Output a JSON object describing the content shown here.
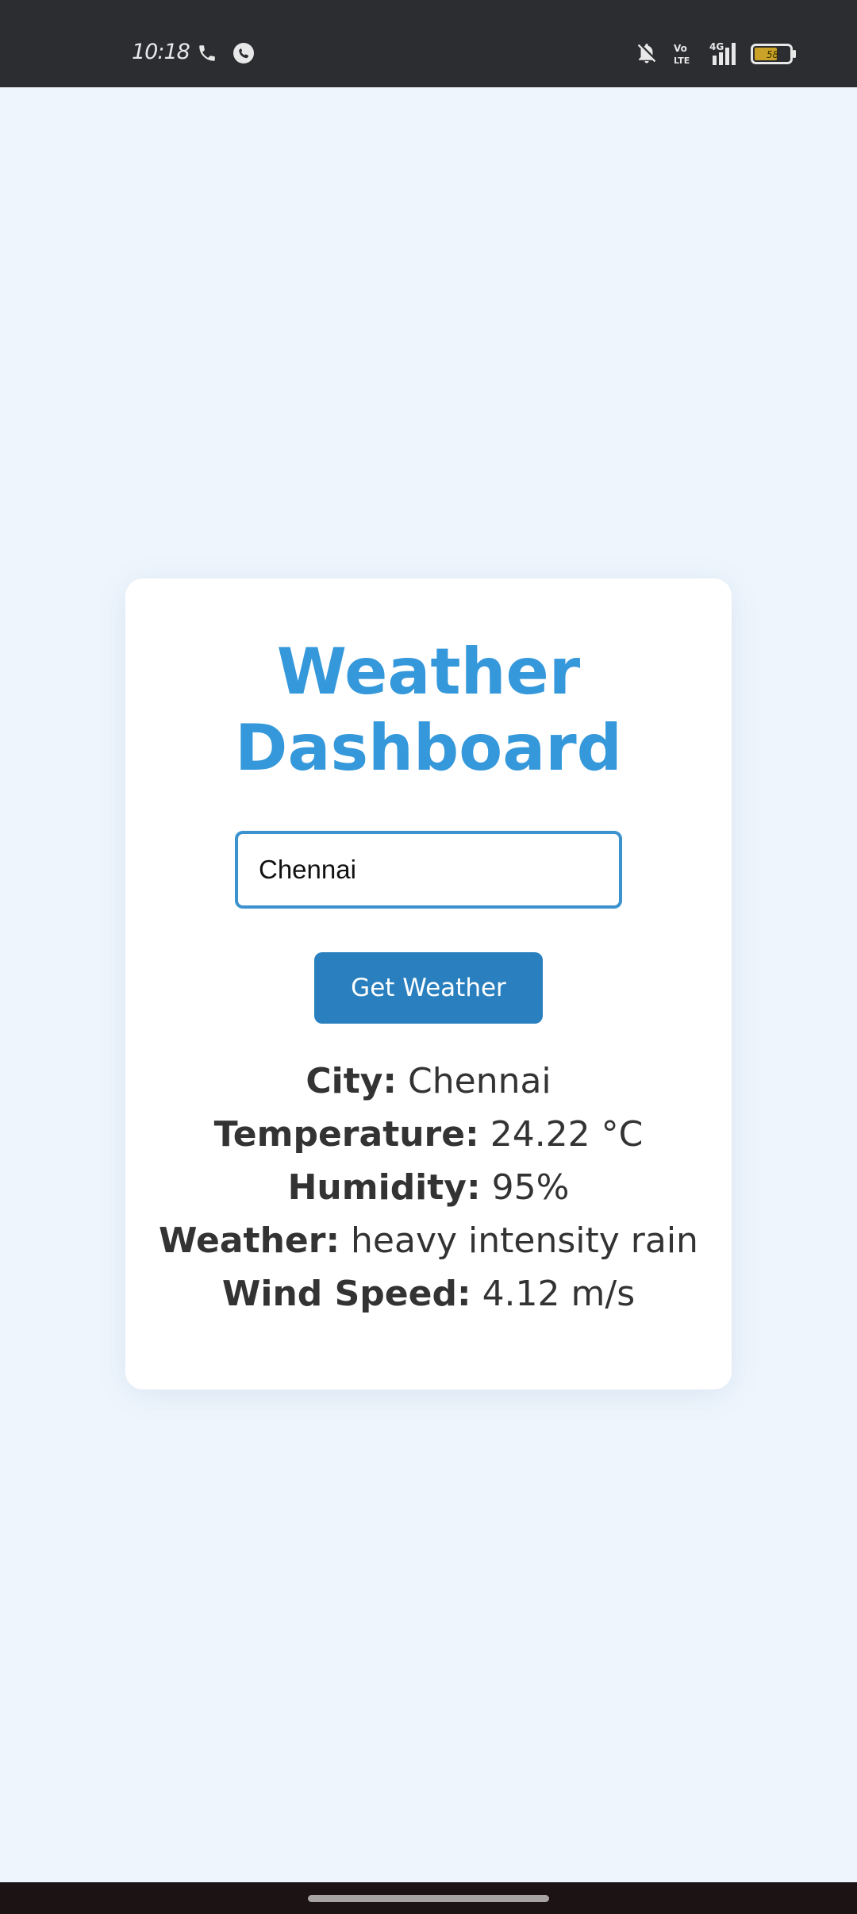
{
  "status_bar": {
    "time": "10:18",
    "left_icons": [
      "phone-icon",
      "whatsapp-icon"
    ],
    "right_icons": [
      "bell-off-icon",
      "volte-icon",
      "signal-4g-icon",
      "battery-icon"
    ],
    "network_label": "4G",
    "volte_label_top": "Vo",
    "volte_label_bottom": "LTE",
    "battery_level": "58",
    "battery_fill_color": "#c9a227"
  },
  "dashboard": {
    "title": "Weather Dashboard",
    "city_input": {
      "value": "Chennai",
      "placeholder": ""
    },
    "button_label": "Get Weather",
    "results": {
      "city_label": "City:",
      "city_value": "Chennai",
      "temperature_label": "Temperature:",
      "temperature_value": "24.22 °C",
      "humidity_label": "Humidity:",
      "humidity_value": "95%",
      "weather_label": "Weather:",
      "weather_value": "heavy intensity rain",
      "wind_label": "Wind Speed:",
      "wind_value": "4.12 m/s"
    }
  },
  "colors": {
    "accent": "#3498db",
    "button": "#2a80bf",
    "background": "#eef5fd",
    "text": "#333333"
  }
}
